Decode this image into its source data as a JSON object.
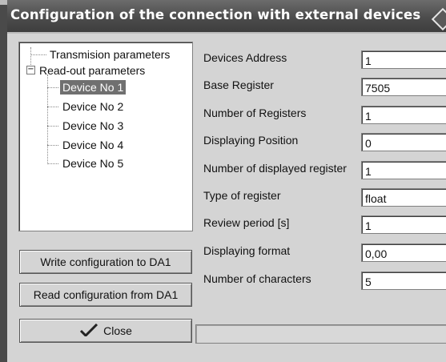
{
  "window": {
    "title": "Configuration of the connection with external devices"
  },
  "tree": {
    "items": [
      {
        "label": "Transmision parameters"
      },
      {
        "label": "Read-out parameters",
        "expander": "−"
      },
      {
        "label": "Device No 1",
        "selected": true
      },
      {
        "label": "Device No 2"
      },
      {
        "label": "Device No 3"
      },
      {
        "label": "Device No 4"
      },
      {
        "label": "Device No 5"
      }
    ]
  },
  "buttons": {
    "write": "Write configuration to DA1",
    "read": "Read configuration from DA1",
    "close": "Close"
  },
  "fields": [
    {
      "label": "Devices Address",
      "value": "1"
    },
    {
      "label": "Base Register",
      "value": "7505"
    },
    {
      "label": "Number of Registers",
      "value": "1"
    },
    {
      "label": "Displaying Position",
      "value": "0"
    },
    {
      "label": "Number of displayed register",
      "value": "1"
    },
    {
      "label": "Type of register",
      "value": "float"
    },
    {
      "label": "Review period [s]",
      "value": "1"
    },
    {
      "label": "Displaying format",
      "value": "0,00"
    },
    {
      "label": "Number of characters",
      "value": "5"
    }
  ],
  "colors": {
    "titlebar": "#4c4c4c",
    "selection": "#707070",
    "dialog": "#d4d4d4"
  },
  "icons": {
    "close_button": "check-icon",
    "title_right": "diamond-icon"
  }
}
